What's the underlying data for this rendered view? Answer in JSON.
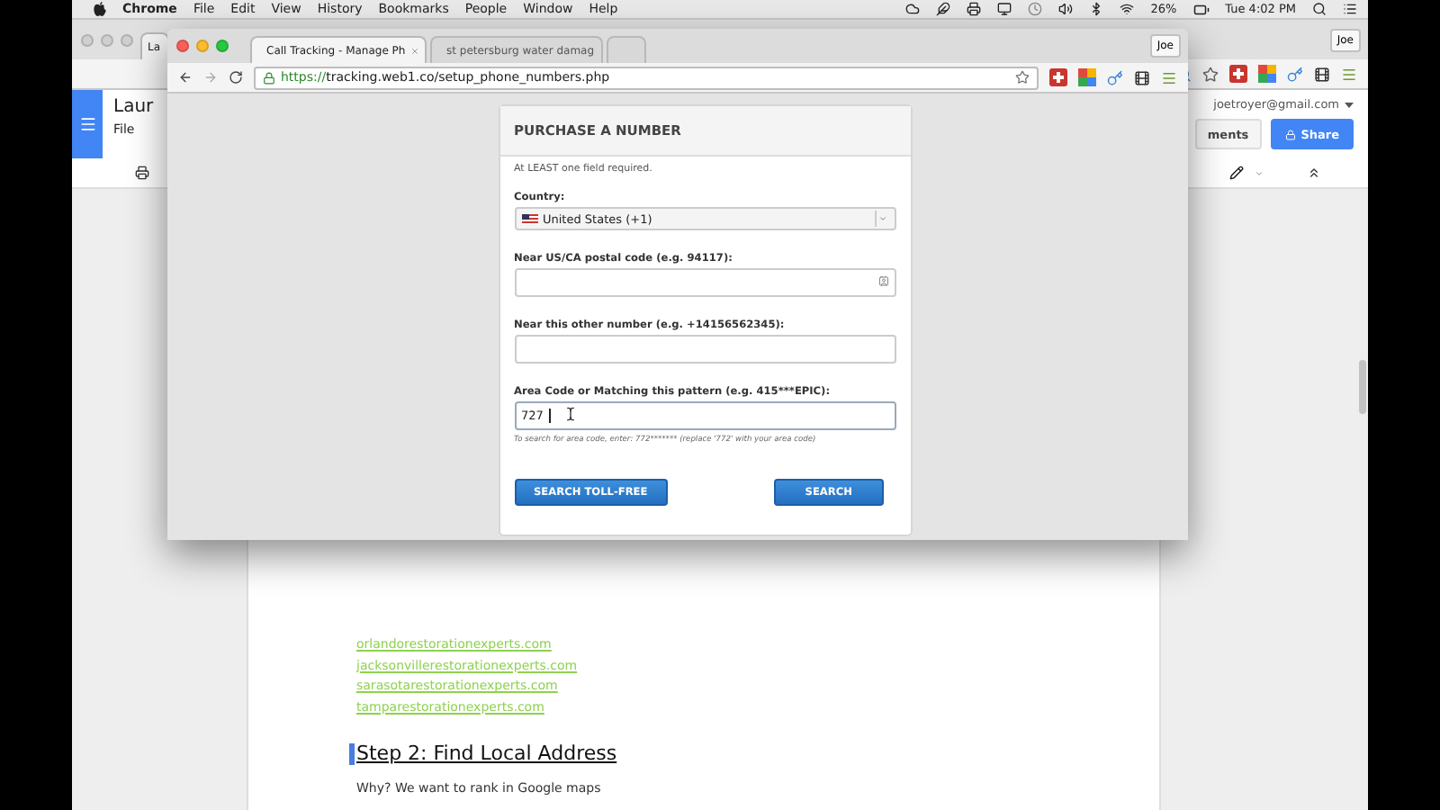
{
  "menu_bar": {
    "app": "Chrome",
    "menus": [
      "File",
      "Edit",
      "View",
      "History",
      "Bookmarks",
      "People",
      "Window",
      "Help"
    ],
    "battery": "26%",
    "clock": "Tue 4:02 PM"
  },
  "back_window": {
    "tabs": [
      {
        "label": "La",
        "selected": true
      }
    ],
    "profile": "Joe",
    "doc": {
      "title": "Laur",
      "menus": [
        "File"
      ],
      "account": "joetroyer@gmail.com",
      "comments_button": "ments",
      "share_button": "Share",
      "links": [
        "orlandorestorationexperts.com",
        "jacksonvillerestorationexperts.com",
        "sarasotarestorationexperts.com",
        "tamparestorationexperts.com"
      ],
      "heading": "Step 2: Find Local Address",
      "paragraph": "Why? We want to rank in Google maps"
    }
  },
  "front_window": {
    "tabs": [
      {
        "label": "Call Tracking - Manage Ph",
        "selected": true
      },
      {
        "label": "st petersburg water damag",
        "selected": false
      }
    ],
    "profile": "Joe",
    "url_scheme": "https://",
    "url_rest": "tracking.web1.co/setup_phone_numbers.php",
    "form": {
      "title": "PURCHASE A NUMBER",
      "note": "At LEAST one field required.",
      "fields": [
        {
          "kind": "select",
          "label": "Country:",
          "value": "United States (+1)"
        },
        {
          "kind": "text",
          "label": "Near US/CA postal code (e.g. 94117):",
          "icon": true
        },
        {
          "kind": "text",
          "label": "Near this other number (e.g. +14156562345):"
        },
        {
          "kind": "text",
          "label": "Area Code or Matching this pattern (e.g. 415***EPIC):",
          "value": "727",
          "focused": true,
          "hint": "To search for area code, enter: 772******* (replace '772' with your area code)"
        }
      ],
      "buttons": [
        "SEARCH TOLL-FREE",
        "SEARCH"
      ]
    }
  }
}
